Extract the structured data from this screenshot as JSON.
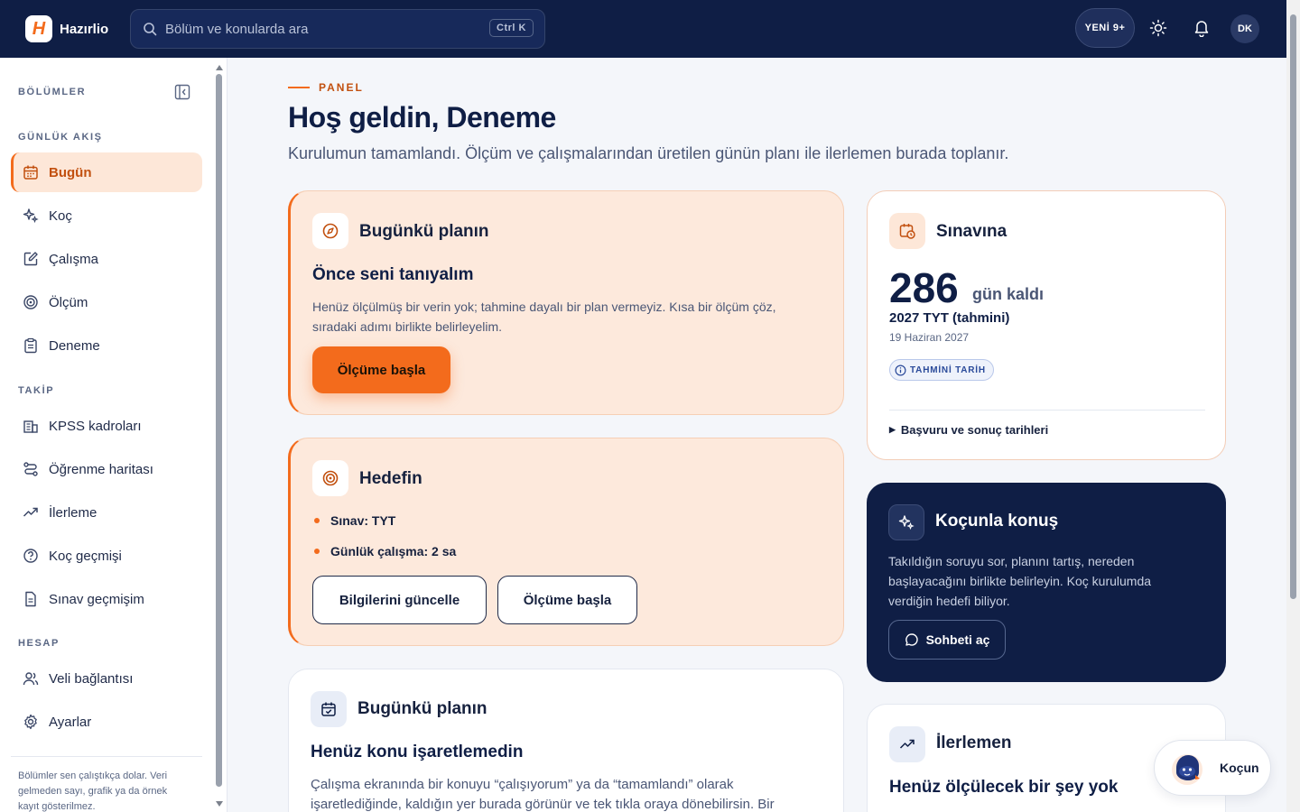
{
  "brand": {
    "logo_letter": "H",
    "name": "Hazırlio",
    "accent": "#f36b1c",
    "navy": "#0f1e45"
  },
  "topbar": {
    "search_placeholder": "Bölüm ve konularda ara",
    "shortcut": "Ctrl K",
    "new_badge": "YENİ 9+",
    "avatar_initials": "DK",
    "icons": [
      "search-icon",
      "sun-icon",
      "bell-icon"
    ]
  },
  "sidebar": {
    "heading": "BÖLÜMLER",
    "sections": [
      {
        "title": "GÜNLÜK AKIŞ",
        "items": [
          {
            "label": "Bugün",
            "icon": "calendar-icon",
            "active": true
          },
          {
            "label": "Koç",
            "icon": "sparkle-icon"
          },
          {
            "label": "Çalışma",
            "icon": "edit-icon"
          },
          {
            "label": "Ölçüm",
            "icon": "target-icon"
          },
          {
            "label": "Deneme",
            "icon": "clipboard-icon"
          }
        ]
      },
      {
        "title": "TAKİP",
        "items": [
          {
            "label": "KPSS kadroları",
            "icon": "building-icon"
          },
          {
            "label": "Öğrenme haritası",
            "icon": "route-icon"
          },
          {
            "label": "İlerleme",
            "icon": "trend-icon"
          },
          {
            "label": "Koç geçmişi",
            "icon": "help-circle-icon"
          },
          {
            "label": "Sınav geçmişim",
            "icon": "file-icon"
          }
        ]
      },
      {
        "title": "HESAP",
        "items": [
          {
            "label": "Veli bağlantısı",
            "icon": "users-icon"
          },
          {
            "label": "Ayarlar",
            "icon": "gear-icon"
          }
        ]
      }
    ],
    "note": "Bölümler sen çalıştıkça dolar. Veri gelmeden sayı, grafik ya da örnek kayıt gösterilmez."
  },
  "main": {
    "eyebrow": "PANEL",
    "title": "Hoş geldin, Deneme",
    "subtitle": "Kurulumun tamamlandı. Ölçüm ve çalışmalarından üretilen günün planı ile ilerlemen burada toplanır.",
    "plan_card": {
      "title": "Bugünkü planın",
      "heading": "Önce seni tanıyalım",
      "body": "Henüz ölçülmüş bir verin yok; tahmine dayalı bir plan vermeyiz. Kısa bir ölçüm çöz, sıradaki adımı birlikte belirleyelim.",
      "button": "Ölçüme başla"
    },
    "goal_card": {
      "title": "Hedefin",
      "bullets": [
        "Sınav: TYT",
        "Günlük çalışma: 2 sa"
      ],
      "button_update": "Bilgilerini güncelle",
      "button_start": "Ölçüme başla"
    },
    "plan_card2": {
      "title": "Bugünkü planın",
      "heading": "Henüz konu işaretlemedin",
      "body": "Çalışma ekranında bir konuyu “çalışıyorum” ya da “tamamlandı” olarak işaretlediğinde, kaldığın yer burada görünür ve tek tıkla oraya dönebilirsin. Bir konu"
    },
    "exam_card": {
      "title": "Sınavına",
      "days": "286",
      "days_unit": "gün kaldı",
      "exam_name": "2027 TYT (tahmini)",
      "date": "19 Haziran 2027",
      "badge": "TAHMİNİ TARİH",
      "details_link": "Başvuru ve sonuç tarihleri"
    },
    "coach_card": {
      "title": "Koçunla konuş",
      "body": "Takıldığın soruyu sor, planını tartış, nereden başlayacağını birlikte belirleyin. Koç kurulumda verdiğin hedefi biliyor.",
      "button": "Sohbeti aç"
    },
    "progress_card": {
      "title": "İlerlemen",
      "heading": "Henüz ölçülecek bir şey yok"
    },
    "coach_pill": "Koçun"
  }
}
